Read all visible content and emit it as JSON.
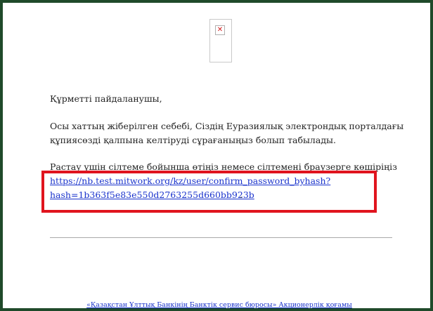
{
  "header": {
    "logo_icon": "broken-image-icon",
    "logo_glyph": "✕"
  },
  "email": {
    "greeting": "Құрметті пайдаланушы,",
    "para1_line1": "Осы хаттың жіберілген себебі, Сіздің Еуразиялық электрондық порталдағы",
    "para1_line2": "құпиясөзді қалпына келтіруді сұрағаныңыз болып табылады.",
    "para2": "Растау үшін сілтеме бойынша өтіңіз немесе сілтемені браузерге көшіріңіз",
    "link_line1": "https://nb.test.mitwork.org/kz/user/confirm_password_byhash?",
    "link_line2": "hash=1b363f5e83e550d2763255d660bb923b",
    "link_tail": "."
  },
  "footer": {
    "link_text": "«Қазақстан Ұлттық Банкінің Банктік сервис бюросы» Акционерлік қоғамы"
  },
  "colors": {
    "frame": "#1f4a2a",
    "highlight": "#e0141e",
    "link": "#1a33cc"
  }
}
